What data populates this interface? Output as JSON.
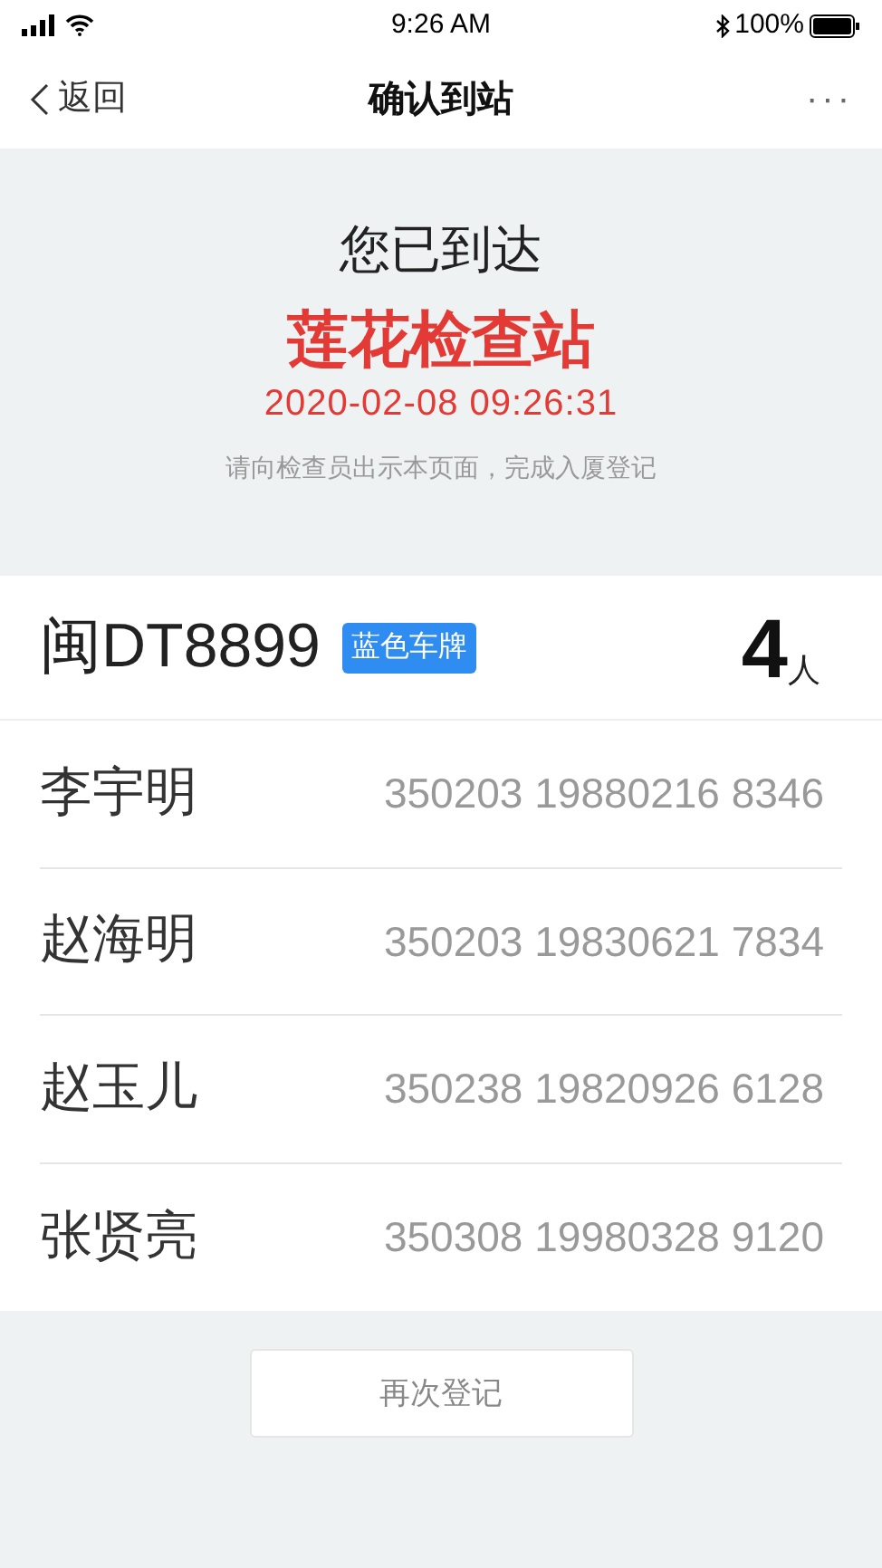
{
  "status_bar": {
    "time": "9:26 AM",
    "battery": "100%"
  },
  "nav": {
    "back": "返回",
    "title": "确认到站",
    "more": "···"
  },
  "arrival": {
    "heading": "您已到达",
    "station": "莲花检查站",
    "datetime": "2020-02-08 09:26:31",
    "note": "请向检查员出示本页面，完成入厦登记"
  },
  "vehicle": {
    "plate": "闽DT8899",
    "plate_tag": "蓝色车牌",
    "count": "4",
    "count_unit": "人"
  },
  "people": [
    {
      "name": "李宇明",
      "id": "350203 19880216 8346"
    },
    {
      "name": "赵海明",
      "id": "350203 19830621 7834"
    },
    {
      "name": "赵玉儿",
      "id": "350238 19820926 6128"
    },
    {
      "name": "张贤亮",
      "id": "350308 19980328 9120"
    }
  ],
  "button": "再次登记"
}
